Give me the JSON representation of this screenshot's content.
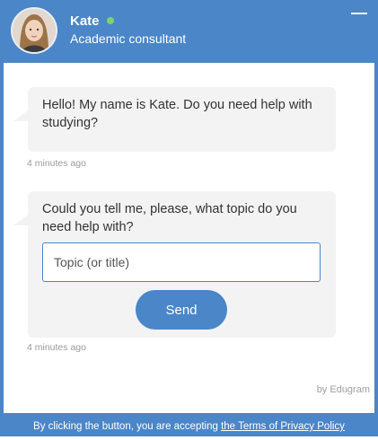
{
  "header": {
    "name": "Kate",
    "role": "Academic consultant",
    "status_color": "#7fd36b",
    "minimize_icon": "minimize-icon"
  },
  "messages": [
    {
      "text": "Hello! My name is Kate. Do you need help with studying?",
      "time": "4 minutes ago"
    },
    {
      "text": "Could you tell me, please, what topic do you need help with?",
      "input_placeholder": "Topic (or title)",
      "button_label": "Send",
      "time": "4 minutes ago"
    }
  ],
  "branding": "by Edugram",
  "footer": {
    "prefix": "By clicking the button, you are accepting ",
    "link": "the Terms of Privacy Policy"
  },
  "colors": {
    "accent": "#4a86c8",
    "bubble": "#f3f3f3"
  }
}
